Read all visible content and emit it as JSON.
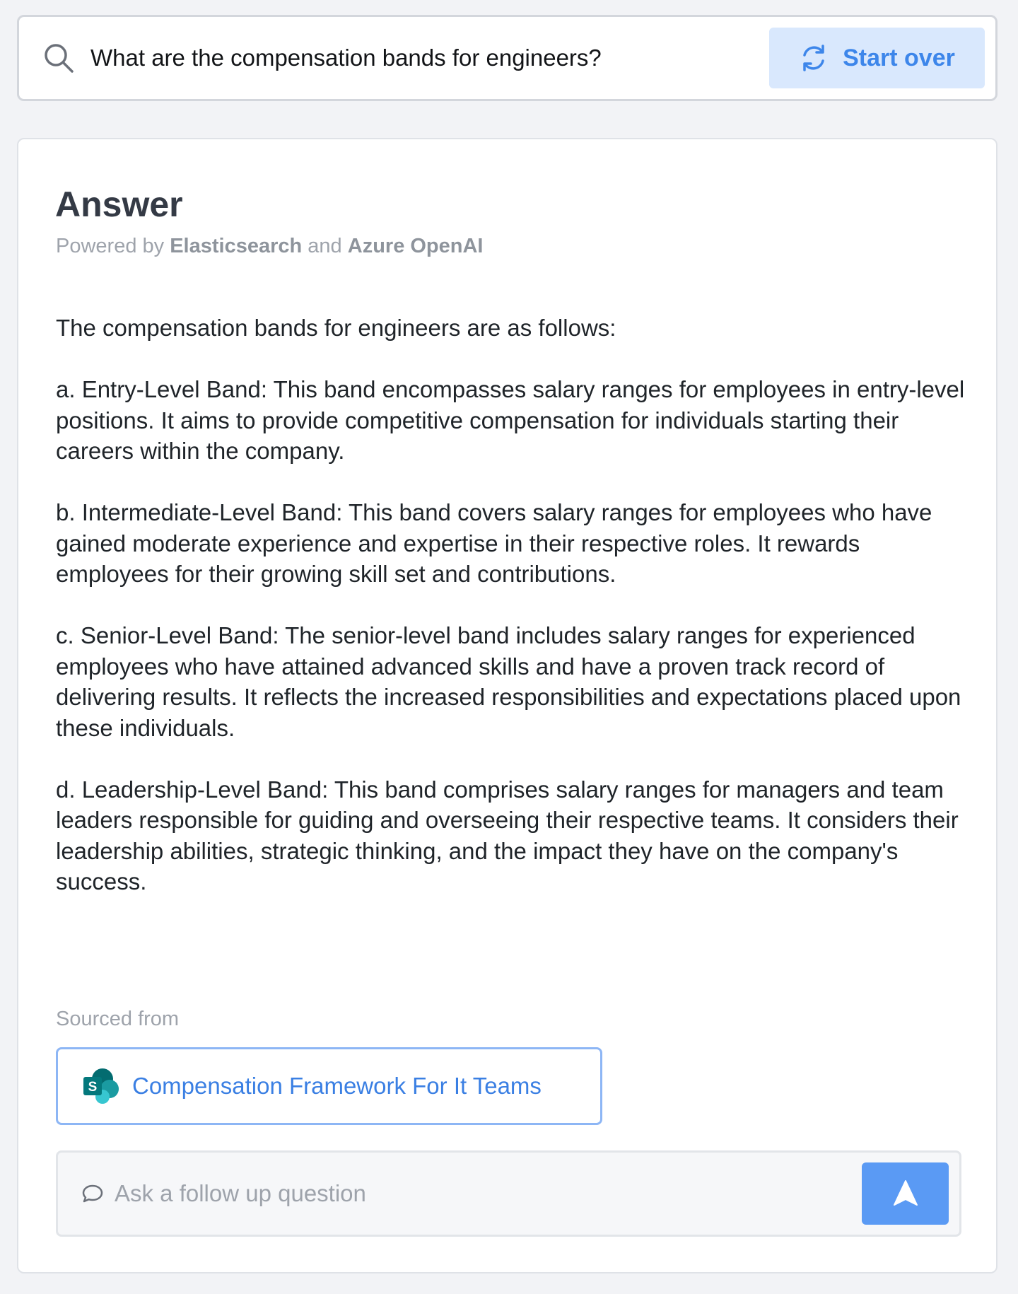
{
  "search": {
    "query": "What are the compensation bands for engineers?",
    "icon": "search-icon",
    "start_over_label": "Start over",
    "start_over_icon": "refresh-icon"
  },
  "answer": {
    "title": "Answer",
    "powered_by": {
      "prefix": "Powered by",
      "provider_1": "Elasticsearch",
      "conjunction": "and",
      "provider_2": "Azure OpenAI"
    },
    "paragraphs": [
      "The compensation bands for engineers are as follows:",
      "a. Entry-Level Band: This band encompasses salary ranges for employees in entry-level positions. It aims to provide competitive compensation for individuals starting their careers within the company.",
      "b. Intermediate-Level Band: This band covers salary ranges for employees who have gained moderate experience and expertise in their respective roles. It rewards employees for their growing skill set and contributions.",
      "c. Senior-Level Band: The senior-level band includes salary ranges for experienced employees who have attained advanced skills and have a proven track record of delivering results. It reflects the increased responsibilities and expectations placed upon these individuals.",
      "d. Leadership-Level Band: This band comprises salary ranges for managers and team leaders responsible for guiding and overseeing their respective teams. It considers their leadership abilities, strategic thinking, and the impact they have on the company's success."
    ]
  },
  "sources": {
    "label": "Sourced from",
    "items": [
      {
        "title": "Compensation Framework For It Teams",
        "icon": "sharepoint-icon"
      }
    ]
  },
  "followup": {
    "placeholder": "Ask a follow up question",
    "icon": "chat-bubble-icon",
    "send_icon": "send-icon"
  },
  "colors": {
    "accent": "#3d86ea",
    "accent_light": "#d9e8fd",
    "send_button": "#5a9af4",
    "page_background": "#f2f3f6",
    "muted_text": "#9ea3ab"
  }
}
